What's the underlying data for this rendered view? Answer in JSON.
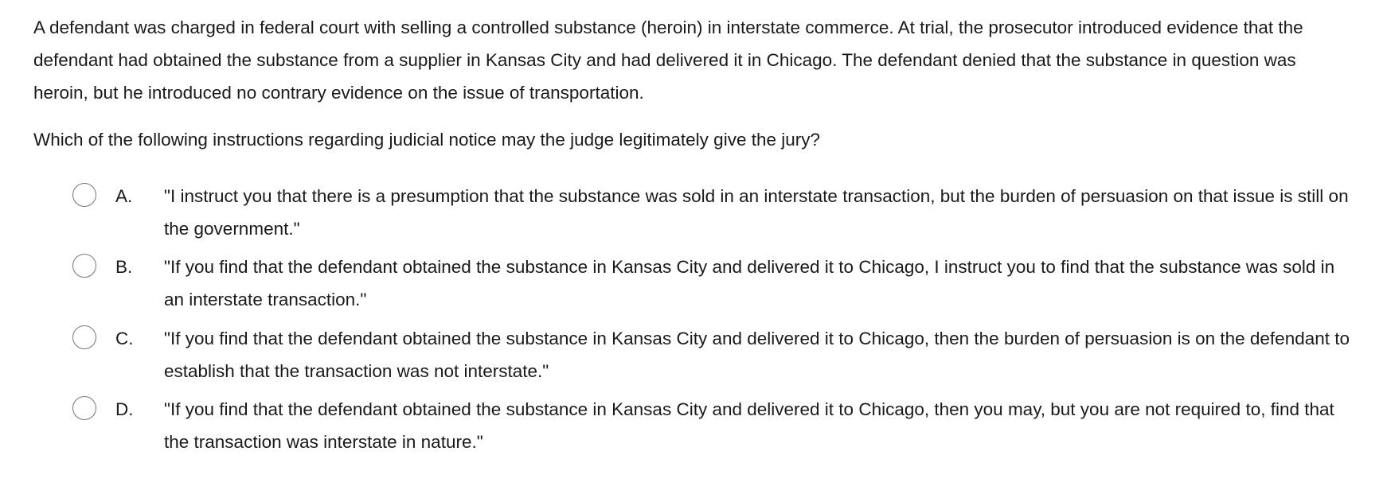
{
  "question": {
    "stem": "A defendant was charged in federal court with selling a controlled substance (heroin) in interstate commerce.  At trial, the prosecutor introduced evidence that the defendant had obtained the substance from a supplier in Kansas City and had delivered it in Chicago.  The defendant denied that the substance in question was heroin, but he introduced no contrary evidence on the issue of transportation.",
    "prompt": "Which of the following instructions regarding judicial notice may the judge legitimately give the jury?"
  },
  "options": [
    {
      "letter": "A.",
      "text": "\"I instruct you that there is a presumption that the substance was sold in an interstate transaction, but the burden of persuasion on that issue is still on the government.\""
    },
    {
      "letter": "B.",
      "text": "\"If you find that the defendant obtained the substance in Kansas City and delivered it to Chicago, I instruct you to find that the substance was sold in an interstate transaction.\""
    },
    {
      "letter": "C.",
      "text": "\"If you find that the defendant obtained the substance in Kansas City and delivered it to Chicago, then the burden of persuasion is on the defendant to establish that the transaction was not interstate.\""
    },
    {
      "letter": "D.",
      "text": "\"If you find that the defendant obtained the substance in Kansas City and delivered it to Chicago, then you may, but you are not required to, find that the transaction was interstate in nature.\""
    }
  ]
}
